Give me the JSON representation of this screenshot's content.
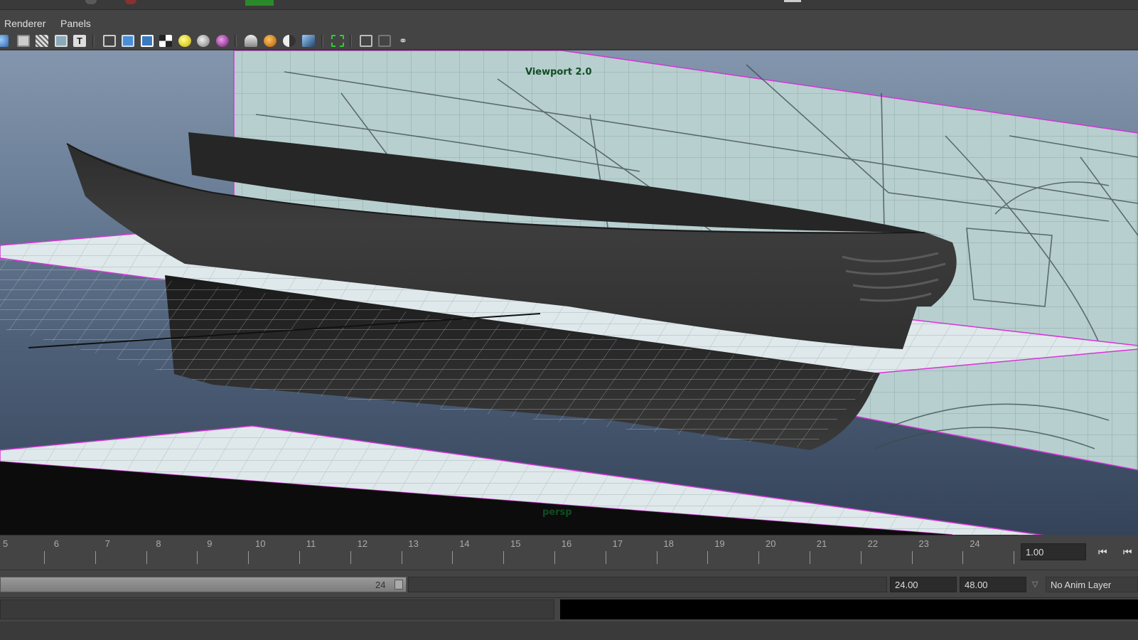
{
  "menu": {
    "renderer": "Renderer",
    "panels": "Panels"
  },
  "toolbar": {
    "icons": [
      "camera-icon",
      "image-plane-icon",
      "grid-icon",
      "film-gate-icon",
      "text-icon",
      "wireframe-cube-icon",
      "smooth-shade-cube-icon",
      "shaded-wireframe-cube-icon",
      "checker-icon",
      "light-bulb-icon",
      "default-light-icon",
      "material-sphere-icon",
      "shadow-icon",
      "textured-sphere-icon",
      "contrast-icon",
      "ambient-occlusion-icon",
      "select-camera-icon",
      "isolate-select-icon",
      "xray-icon",
      "node-graph-icon"
    ]
  },
  "viewport": {
    "renderer_label": "Viewport 2.0",
    "camera_label": "persp"
  },
  "timeline": {
    "ticks": [
      "5",
      "6",
      "7",
      "8",
      "9",
      "10",
      "11",
      "12",
      "13",
      "14",
      "15",
      "16",
      "17",
      "18",
      "19",
      "20",
      "21",
      "22",
      "23",
      "24"
    ],
    "current_time": "1.00"
  },
  "range": {
    "bar_end": "24",
    "end_time": "24.00",
    "playback_end": "48.00",
    "anim_layer": "No Anim Layer"
  },
  "colors": {
    "ui_background": "#444444",
    "image_plane_border": "#d733d7",
    "hud_text": "#0f4d22"
  }
}
